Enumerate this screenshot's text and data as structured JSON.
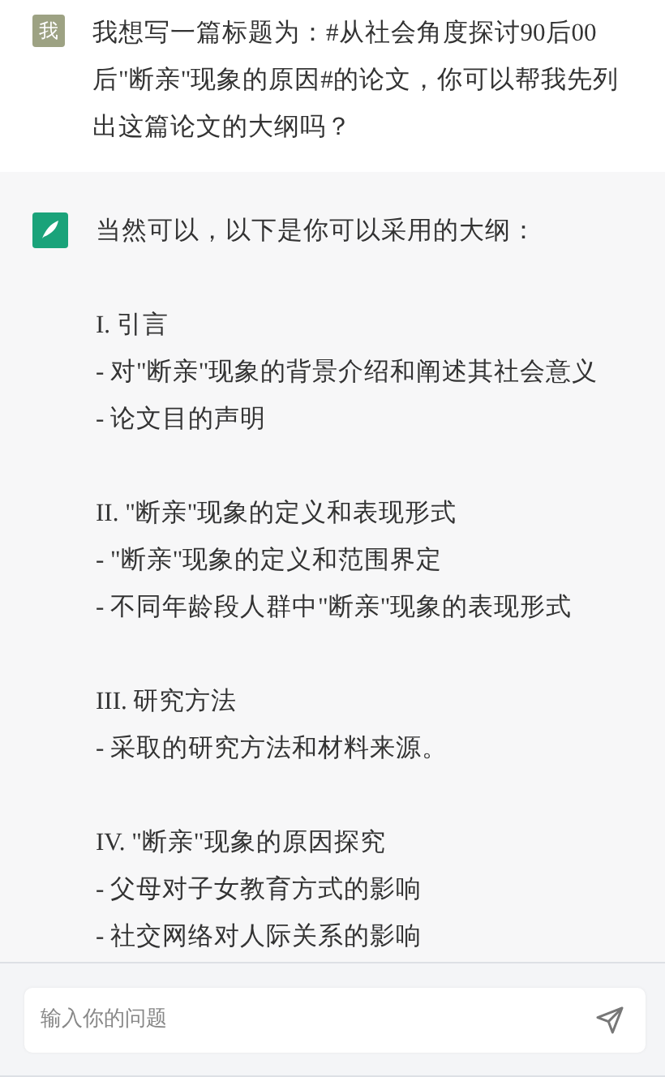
{
  "user_message": {
    "avatar": "我",
    "text": "我想写一篇标题为：#从社会角度探讨90后00后\"断亲\"现象的原因#的论文，你可以帮我先列出这篇论文的大纲吗？"
  },
  "assistant_message": {
    "intro": "当然可以，以下是你可以采用的大纲：",
    "sections": [
      {
        "heading": "I. 引言",
        "items": [
          "- 对\"断亲\"现象的背景介绍和阐述其社会意义",
          "- 论文目的声明"
        ]
      },
      {
        "heading": "II. \"断亲\"现象的定义和表现形式",
        "items": [
          "- \"断亲\"现象的定义和范围界定",
          "- 不同年龄段人群中\"断亲\"现象的表现形式"
        ]
      },
      {
        "heading": "III. 研究方法",
        "items": [
          "- 采取的研究方法和材料来源。"
        ]
      },
      {
        "heading": "IV. \"断亲\"现象的原因探究",
        "items": [
          "- 父母对子女教育方式的影响",
          "- 社交网络对人际关系的影响"
        ]
      }
    ]
  },
  "input": {
    "placeholder": "输入你的问题"
  }
}
